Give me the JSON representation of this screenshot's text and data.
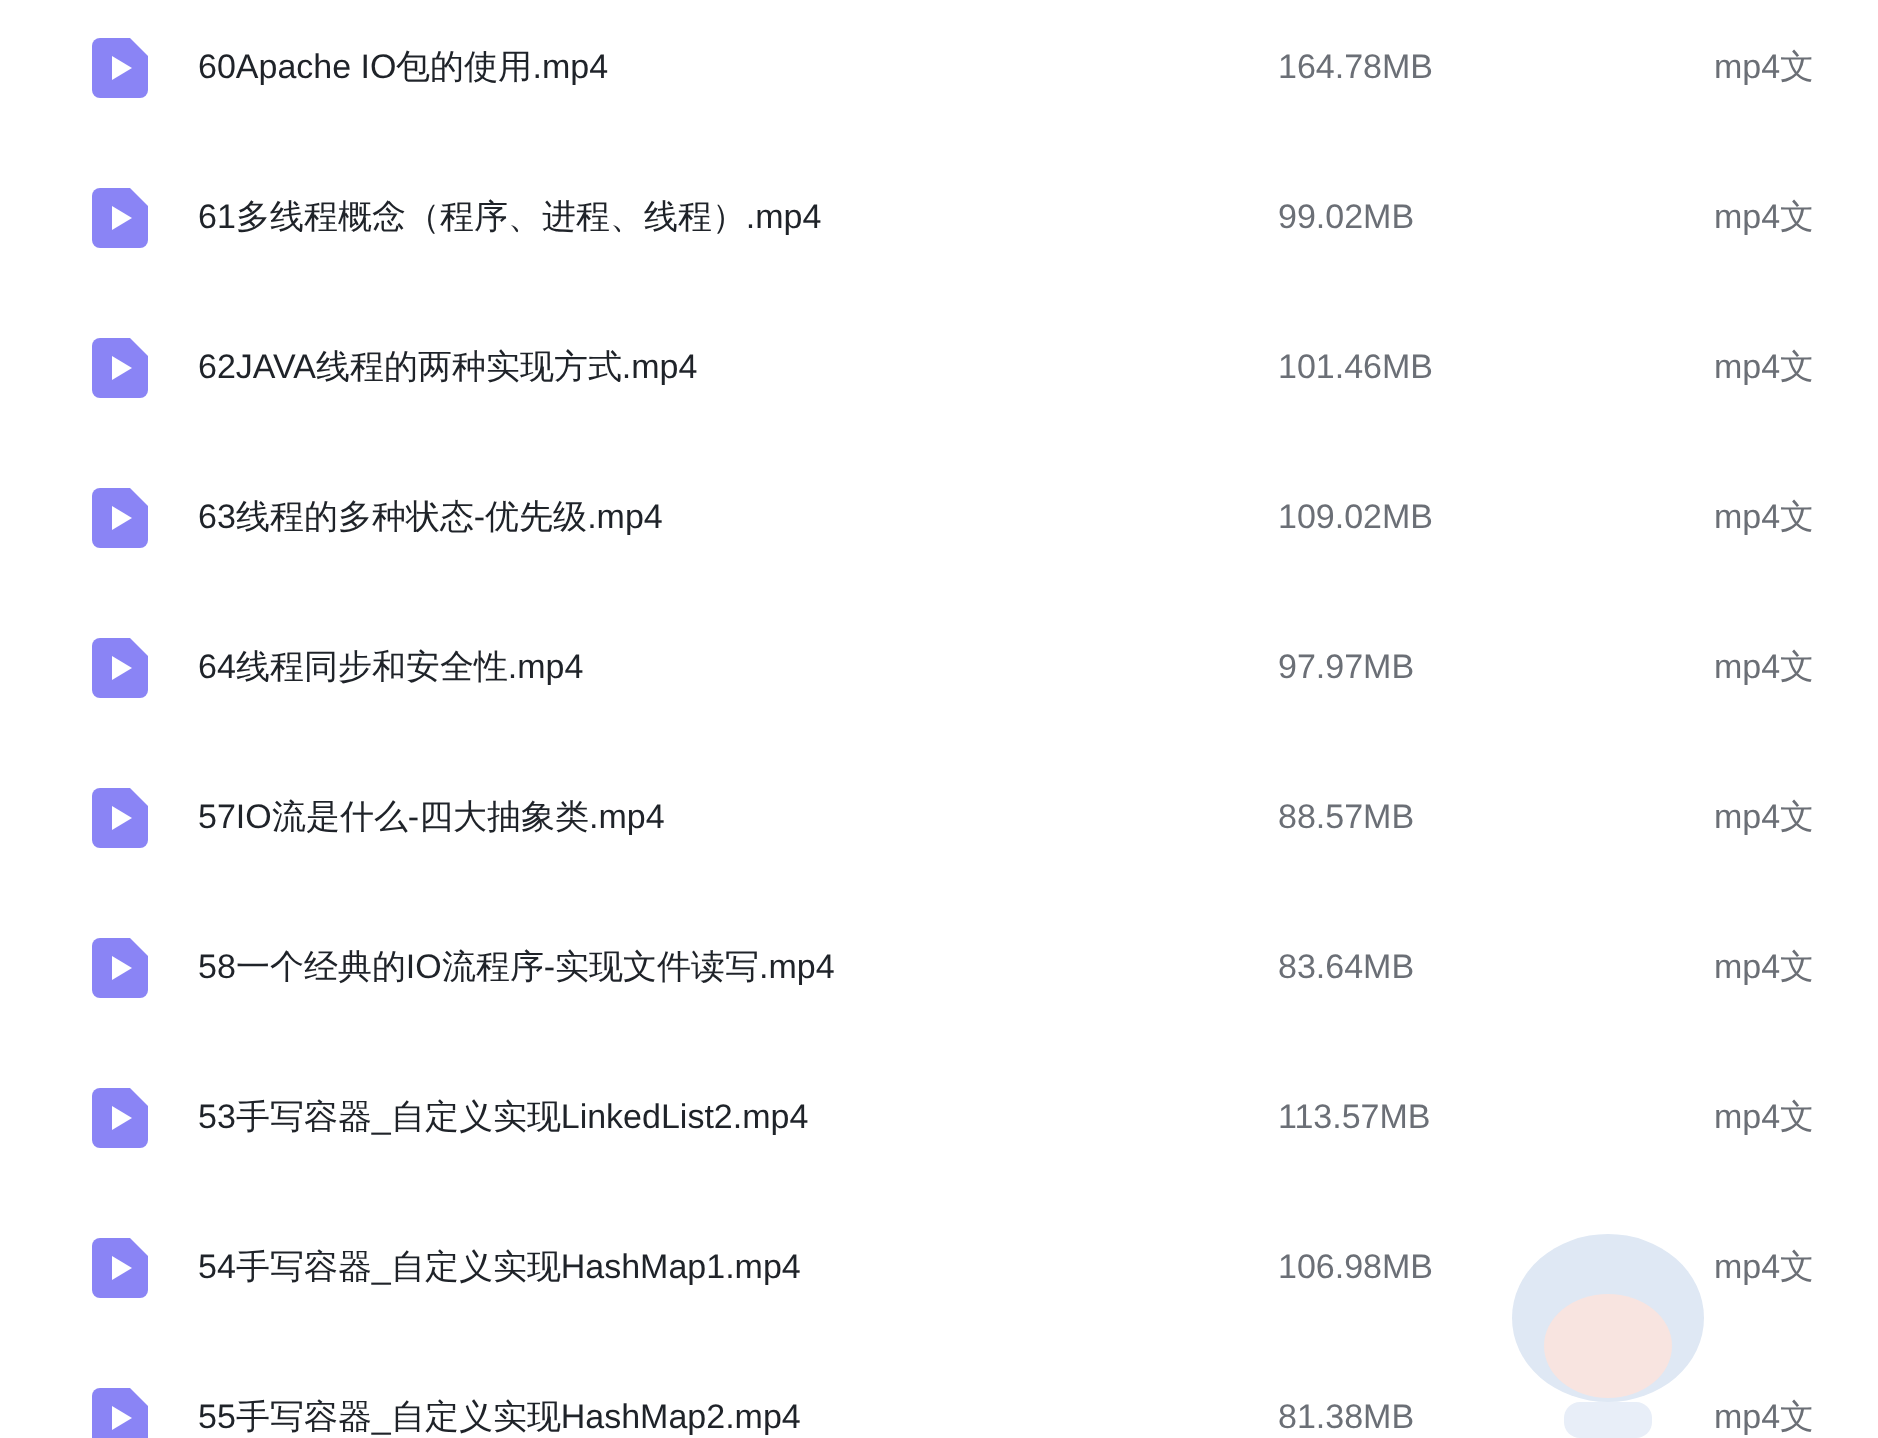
{
  "files": [
    {
      "name": "60Apache IO包的使用.mp4",
      "size": "164.78MB",
      "type": "mp4文"
    },
    {
      "name": "61多线程概念（程序、进程、线程）.mp4",
      "size": "99.02MB",
      "type": "mp4文"
    },
    {
      "name": "62JAVA线程的两种实现方式.mp4",
      "size": "101.46MB",
      "type": "mp4文"
    },
    {
      "name": "63线程的多种状态-优先级.mp4",
      "size": "109.02MB",
      "type": "mp4文"
    },
    {
      "name": "64线程同步和安全性.mp4",
      "size": "97.97MB",
      "type": "mp4文"
    },
    {
      "name": "57IO流是什么-四大抽象类.mp4",
      "size": "88.57MB",
      "type": "mp4文"
    },
    {
      "name": "58一个经典的IO流程序-实现文件读写.mp4",
      "size": "83.64MB",
      "type": "mp4文"
    },
    {
      "name": "53手写容器_自定义实现LinkedList2.mp4",
      "size": "113.57MB",
      "type": "mp4文"
    },
    {
      "name": "54手写容器_自定义实现HashMap1.mp4",
      "size": "106.98MB",
      "type": "mp4文"
    },
    {
      "name": "55手写容器_自定义实现HashMap2.mp4",
      "size": "81.38MB",
      "type": "mp4文"
    }
  ]
}
